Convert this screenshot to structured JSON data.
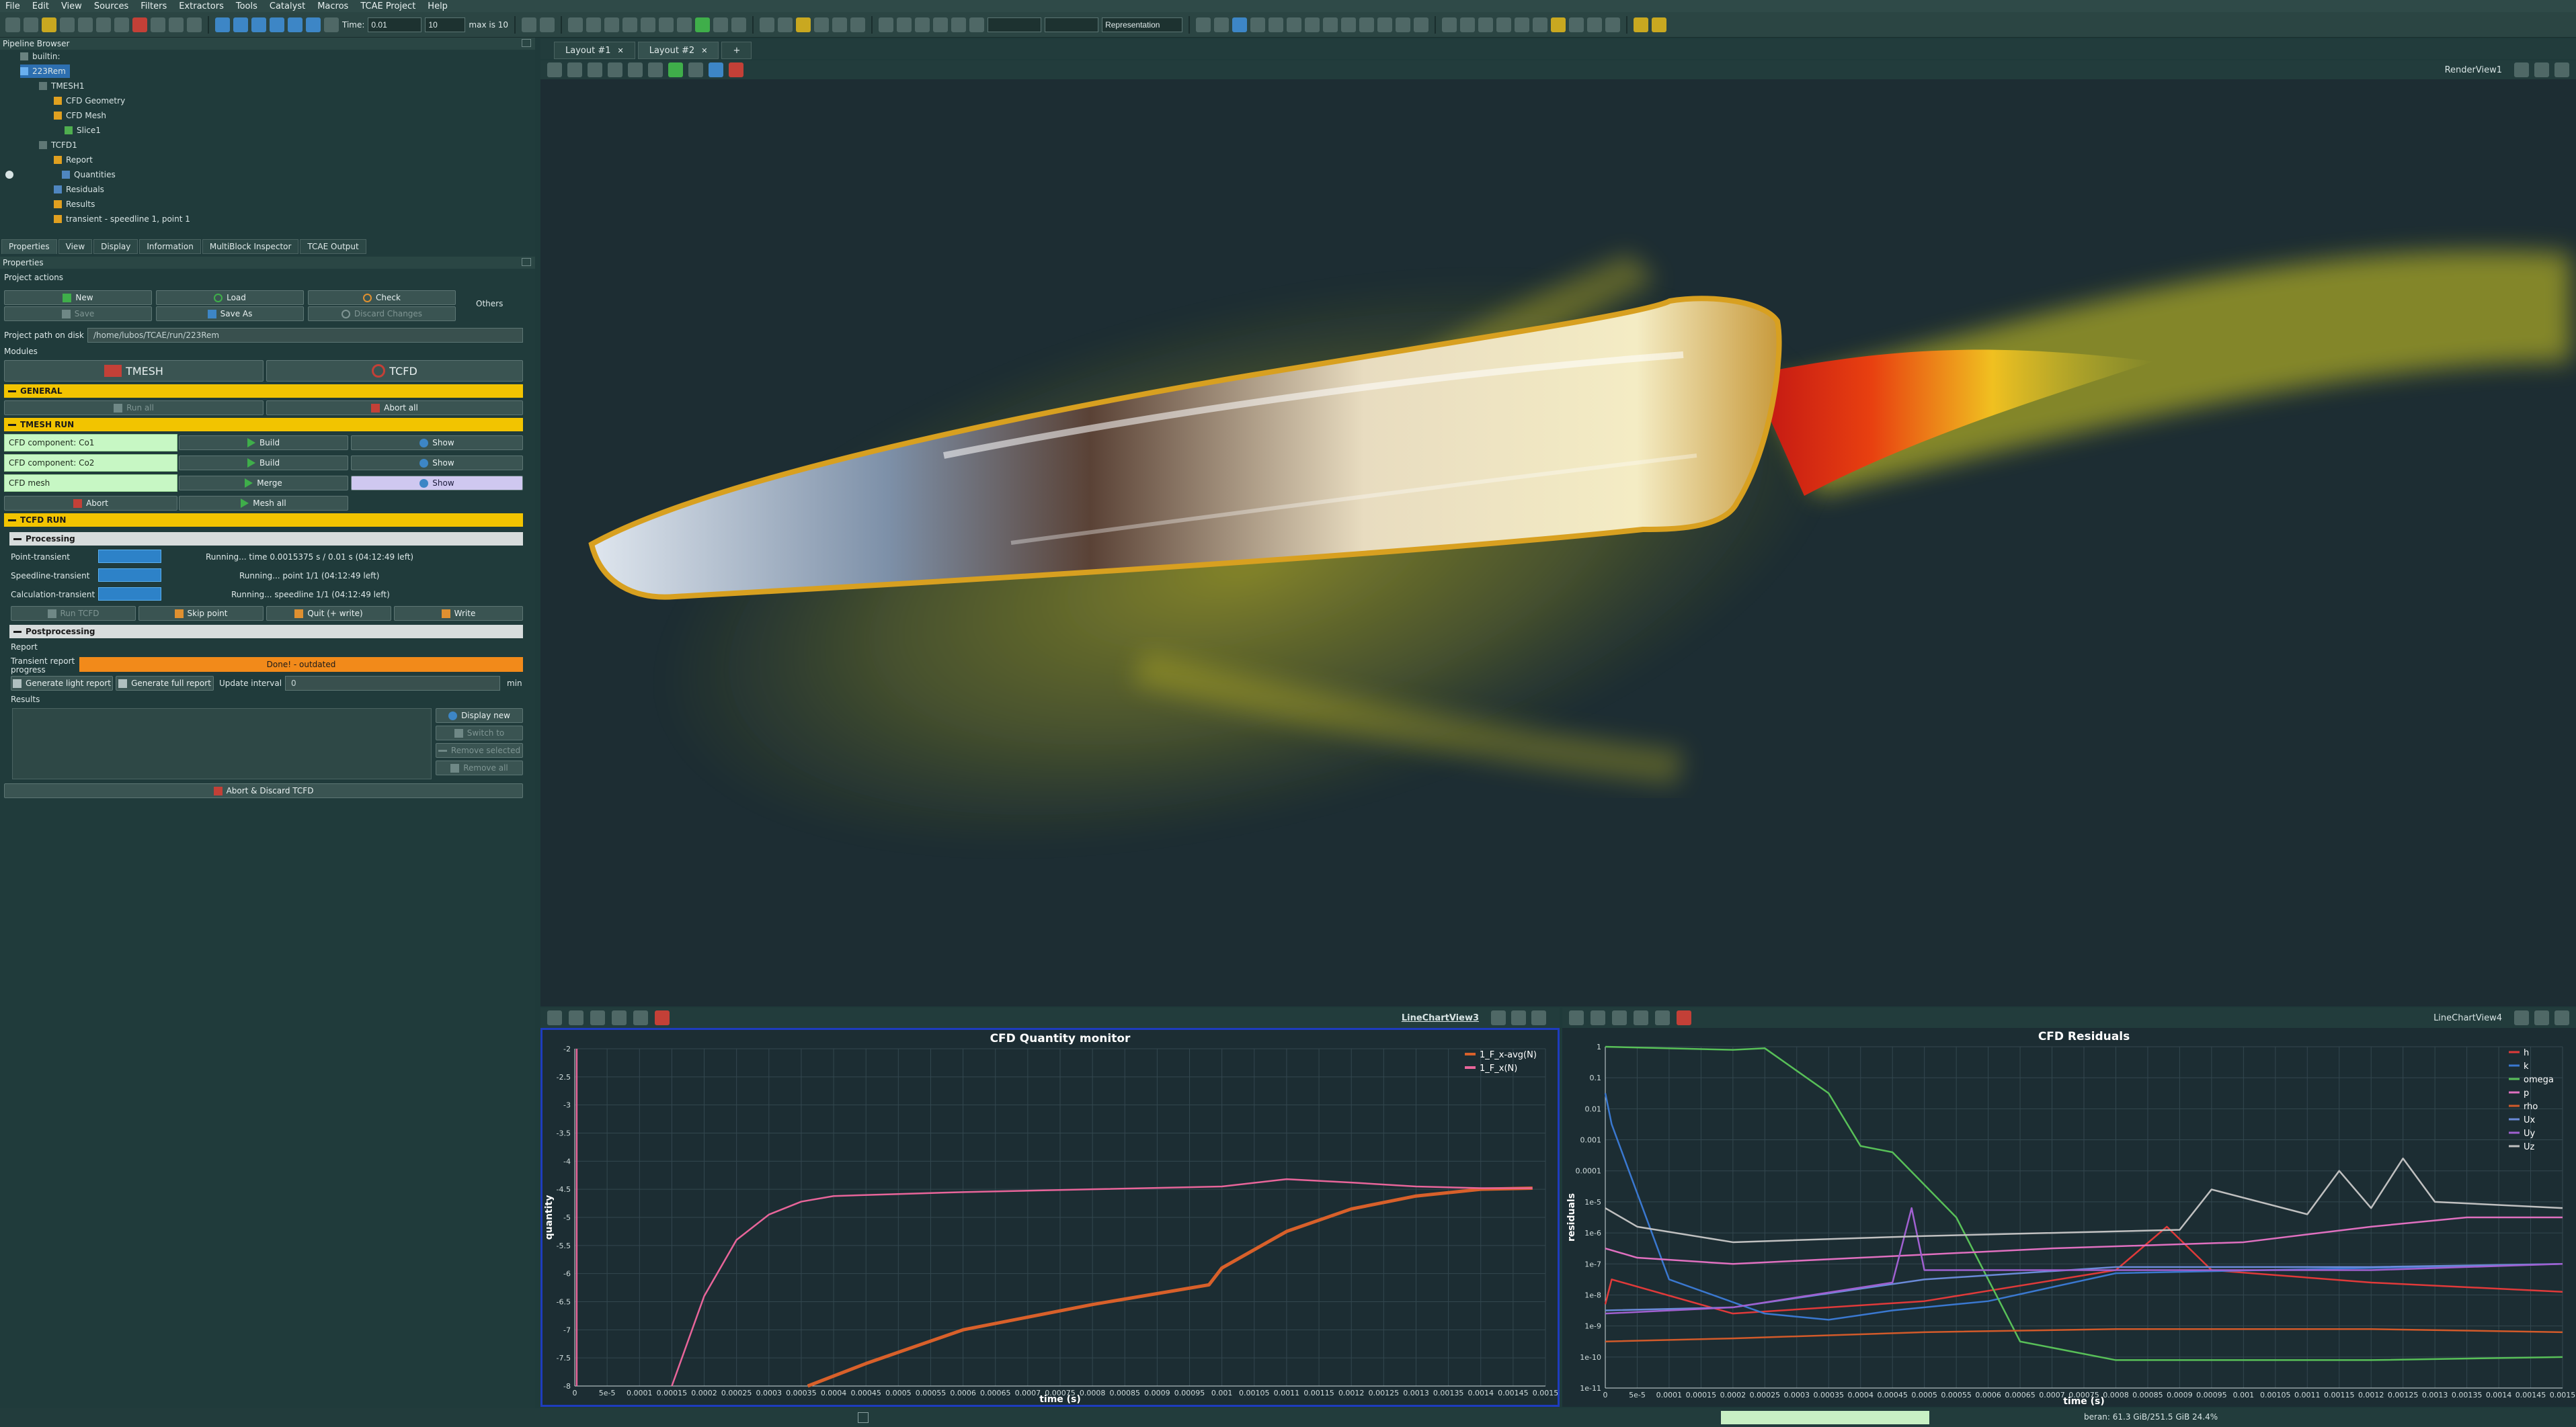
{
  "menu": [
    "File",
    "Edit",
    "View",
    "Sources",
    "Filters",
    "Extractors",
    "Tools",
    "Catalyst",
    "Macros",
    "TCAE Project",
    "Help"
  ],
  "toolbar": {
    "time_label": "Time:",
    "time_value": "0.01",
    "step_value": "10",
    "max_label": "max is 10",
    "representation": "Representation"
  },
  "pipeline": {
    "title": "Pipeline Browser",
    "nodes": [
      "builtin:",
      "223Rem",
      "TMESH1",
      "CFD Geometry",
      "CFD Mesh",
      "Slice1",
      "TCFD1",
      "Report",
      "Quantities",
      "Residuals",
      "Results",
      "transient - speedline 1, point 1"
    ]
  },
  "panel_tabs": [
    "Properties",
    "View",
    "Display",
    "Information",
    "MultiBlock Inspector",
    "TCAE Output"
  ],
  "properties": {
    "title": "Properties",
    "project_actions": "Project actions",
    "new": "New",
    "load": "Load",
    "check": "Check",
    "others": "Others",
    "save": "Save",
    "save_as": "Save As",
    "discard": "Discard Changes",
    "path_label": "Project path on disk",
    "path": "/home/lubos/TCAE/run/223Rem",
    "modules": "Modules",
    "tmesh": "TMESH",
    "tcfd": "TCFD",
    "general": "GENERAL",
    "run_all": "Run all",
    "abort_all": "Abort all",
    "tmesh_run": "TMESH RUN",
    "components": [
      {
        "name": "CFD component: Co1",
        "action": "Build",
        "view": "Show"
      },
      {
        "name": "CFD component: Co2",
        "action": "Build",
        "view": "Show"
      },
      {
        "name": "CFD mesh",
        "action": "Merge",
        "view": "Show"
      }
    ],
    "abort": "Abort",
    "mesh_all": "Mesh all",
    "tcfd_run": "TCFD RUN",
    "processing": "Processing",
    "runs": [
      {
        "label": "Point-transient",
        "status": "Running... time 0.0015375 s / 0.01 s (04:12:49 left)"
      },
      {
        "label": "Speedline-transient",
        "status": "Running... point 1/1 (04:12:49 left)"
      },
      {
        "label": "Calculation-transient",
        "status": "Running... speedline 1/1 (04:12:49 left)"
      }
    ],
    "run_tcfd": "Run TCFD",
    "skip_point": "Skip point",
    "quit_write": "Quit (+ write)",
    "write": "Write",
    "postprocessing": "Postprocessing",
    "report": "Report",
    "transient_report": "Transient report progress",
    "report_status": "Done! - outdated",
    "gen_light": "Generate light report",
    "gen_full": "Generate full report",
    "update_interval": "Update interval",
    "interval_value": "0",
    "interval_unit": "min",
    "results": "Results",
    "display_new": "Display new",
    "switch_to": "Switch to",
    "remove_selected": "Remove selected",
    "remove_all": "Remove all",
    "abort_discard": "Abort & Discard TCFD"
  },
  "layout_tabs": [
    "Layout #1",
    "Layout #2"
  ],
  "render_view_label": "RenderView1",
  "chart1_view_label": "LineChartView3",
  "chart2_view_label": "LineChartView4",
  "status_memory": "beran: 61.3 GiB/251.5 GiB 24.4%",
  "chart_data": [
    {
      "type": "line",
      "title": "CFD Quantity monitor",
      "xlabel": "time (s)",
      "ylabel": "quantity",
      "xlim": [
        0,
        0.0015
      ],
      "ylim": [
        -8,
        -2
      ],
      "yticks": [
        -2,
        -2.5,
        -3,
        -3.5,
        -4,
        -4.5,
        -5,
        -5.5,
        -6,
        -6.5,
        -7,
        -7.5,
        -8
      ],
      "xticks": [
        "0",
        "5e-5",
        "0.0001",
        "0.00015",
        "0.0002",
        "0.00025",
        "0.0003",
        "0.00035",
        "0.0004",
        "0.00045",
        "0.0005",
        "0.00055",
        "0.0006",
        "0.00065",
        "0.0007",
        "0.00075",
        "0.0008",
        "0.00085",
        "0.0009",
        "0.00095",
        "0.001",
        "0.00105",
        "0.0011",
        "0.00115",
        "0.0012",
        "0.00125",
        "0.0013",
        "0.00135",
        "0.0014",
        "0.00145",
        "0.0015"
      ],
      "legend": "top-right",
      "grid": true,
      "series": [
        {
          "name": "1_F_x-avg(N)",
          "color": "#d8602a",
          "x": [
            0.00036,
            0.00045,
            0.0006,
            0.0008,
            0.00098,
            0.001,
            0.0011,
            0.0012,
            0.0013,
            0.0014,
            0.00148
          ],
          "y": [
            -8,
            -7.6,
            -7.0,
            -6.55,
            -6.2,
            -5.9,
            -5.25,
            -4.85,
            -4.62,
            -4.5,
            -4.48
          ]
        },
        {
          "name": "1_F_x(N)",
          "color": "#e8659a",
          "x": [
            0.00015,
            0.0002,
            0.00025,
            0.0003,
            0.00035,
            0.0004,
            0.0006,
            0.0008,
            0.001,
            0.0011,
            0.0012,
            0.0013,
            0.0014,
            0.00148
          ],
          "y": [
            -8,
            -6.4,
            -5.4,
            -4.95,
            -4.72,
            -4.62,
            -4.55,
            -4.5,
            -4.45,
            -4.32,
            -4.38,
            -4.45,
            -4.48,
            -4.48
          ]
        },
        {
          "name": "",
          "color": "#e8659a",
          "x": [
            3e-06,
            3e-06
          ],
          "y": [
            -8,
            -2
          ]
        }
      ]
    },
    {
      "type": "line",
      "title": "CFD Residuals",
      "xlabel": "time (s)",
      "ylabel": "residuals",
      "yscale": "log",
      "xlim": [
        0,
        0.0015
      ],
      "ylim": [
        1e-11,
        1
      ],
      "yticks": [
        "1",
        "0.1",
        "0.01",
        "0.001",
        "0.0001",
        "1e-5",
        "1e-6",
        "1e-7",
        "1e-8",
        "1e-9",
        "1e-10",
        "1e-11"
      ],
      "legend": "top-right",
      "grid": true,
      "series": [
        {
          "name": "h",
          "color": "#e03a3a",
          "x": [
            0,
            1e-05,
            0.0002,
            0.0005,
            0.0008,
            0.00088,
            0.00095,
            0.0012,
            0.0015
          ],
          "y": [
            -8.3,
            -7.5,
            -8.6,
            -8.2,
            -7.2,
            -5.8,
            -7.2,
            -7.6,
            -7.9
          ]
        },
        {
          "name": "k",
          "color": "#3a78d0",
          "x": [
            0,
            1e-05,
            0.0001,
            0.00025,
            0.00035,
            0.00045,
            0.0006,
            0.0008,
            0.0015
          ],
          "y": [
            -1.5,
            -2.5,
            -7.5,
            -8.6,
            -8.8,
            -8.5,
            -8.2,
            -7.3,
            -7
          ]
        },
        {
          "name": "omega",
          "color": "#58c058",
          "x": [
            0,
            0.0002,
            0.00025,
            0.00035,
            0.0004,
            0.00045,
            0.00055,
            0.00065,
            0.0008,
            0.0012,
            0.0015
          ],
          "y": [
            0,
            -0.1,
            -0.05,
            -1.5,
            -3.2,
            -3.4,
            -5.5,
            -9.5,
            -10.1,
            -10.1,
            -10
          ]
        },
        {
          "name": "p",
          "color": "#e070c0",
          "x": [
            0,
            5e-05,
            0.0002,
            0.0004,
            0.0007,
            0.001,
            0.0012,
            0.00135,
            0.0015
          ],
          "y": [
            -6.5,
            -6.8,
            -7,
            -6.8,
            -6.5,
            -6.3,
            -5.8,
            -5.5,
            -5.5
          ]
        },
        {
          "name": "rho",
          "color": "#d25a2a",
          "x": [
            0,
            0.0002,
            0.0005,
            0.0008,
            0.0012,
            0.0015
          ],
          "y": [
            -9.5,
            -9.4,
            -9.2,
            -9.1,
            -9.1,
            -9.2
          ]
        },
        {
          "name": "Ux",
          "color": "#6a8ad8",
          "x": [
            0,
            0.0002,
            0.0005,
            0.0008,
            0.0012,
            0.0015
          ],
          "y": [
            -8.5,
            -8.4,
            -7.5,
            -7.1,
            -7.1,
            -7
          ]
        },
        {
          "name": "Uy",
          "color": "#a060d0",
          "x": [
            0,
            0.0002,
            0.00045,
            0.00048,
            0.0005,
            0.0008,
            0.0012,
            0.0015
          ],
          "y": [
            -8.6,
            -8.4,
            -7.6,
            -5.2,
            -7.2,
            -7.2,
            -7.2,
            -7
          ]
        },
        {
          "name": "Uz",
          "color": "#c0c0c0",
          "x": [
            0,
            5e-05,
            0.0002,
            0.0005,
            0.0009,
            0.00095,
            0.0011,
            0.00115,
            0.0012,
            0.00125,
            0.0013,
            0.0015
          ],
          "y": [
            -5.2,
            -5.8,
            -6.3,
            -6.1,
            -5.9,
            -4.6,
            -5.4,
            -4,
            -5.2,
            -3.6,
            -5,
            -5.2
          ]
        }
      ]
    }
  ]
}
